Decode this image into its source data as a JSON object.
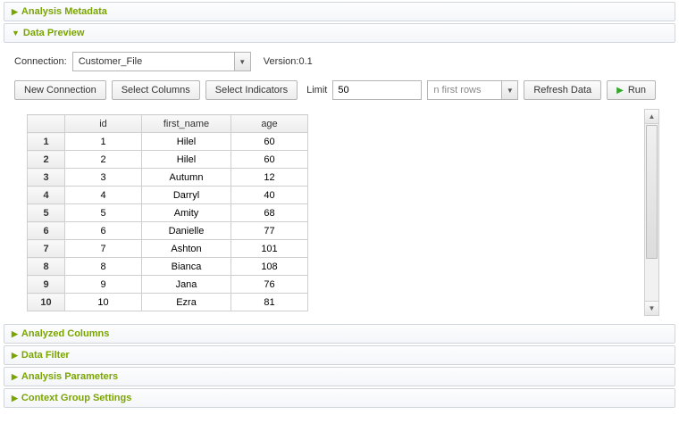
{
  "sections": {
    "metadata": "Analysis Metadata",
    "preview": "Data Preview",
    "analyzed_columns": "Analyzed Columns",
    "data_filter": "Data Filter",
    "analysis_params": "Analysis Parameters",
    "context_group": "Context Group Settings"
  },
  "connection": {
    "label": "Connection:",
    "value": "Customer_File",
    "version": "Version:0.1"
  },
  "toolbar": {
    "new_connection": "New Connection",
    "select_columns": "Select Columns",
    "select_indicators": "Select Indicators",
    "limit_label": "Limit",
    "limit_value": "50",
    "rows_mode": "n first rows",
    "refresh": "Refresh Data",
    "run": "Run"
  },
  "table": {
    "headers": [
      "id",
      "first_name",
      "age"
    ],
    "rows": [
      {
        "n": "1",
        "id": "1",
        "first_name": "Hilel",
        "age": "60"
      },
      {
        "n": "2",
        "id": "2",
        "first_name": "Hilel",
        "age": "60"
      },
      {
        "n": "3",
        "id": "3",
        "first_name": "Autumn",
        "age": "12"
      },
      {
        "n": "4",
        "id": "4",
        "first_name": "Darryl",
        "age": "40"
      },
      {
        "n": "5",
        "id": "5",
        "first_name": "Amity",
        "age": "68"
      },
      {
        "n": "6",
        "id": "6",
        "first_name": "Danielle",
        "age": "77"
      },
      {
        "n": "7",
        "id": "7",
        "first_name": "Ashton",
        "age": "101"
      },
      {
        "n": "8",
        "id": "8",
        "first_name": "Bianca",
        "age": "108"
      },
      {
        "n": "9",
        "id": "9",
        "first_name": "Jana",
        "age": "76"
      },
      {
        "n": "10",
        "id": "10",
        "first_name": "Ezra",
        "age": "81"
      }
    ]
  }
}
